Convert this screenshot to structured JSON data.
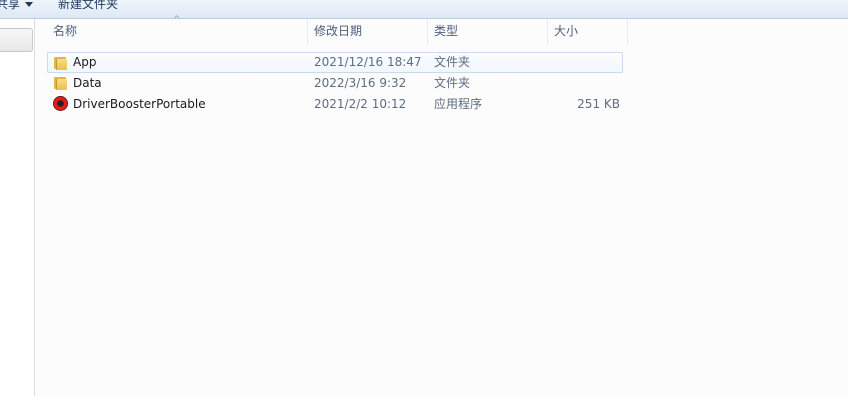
{
  "toolbar": {
    "share_label": "共享",
    "new_folder_label": "新建文件夹"
  },
  "columns": {
    "name": "名称",
    "date": "修改日期",
    "type": "类型",
    "size": "大小"
  },
  "files": [
    {
      "name": "App",
      "date": "2021/12/16 18:47",
      "type": "文件夹",
      "size": "",
      "icon": "folder-icon",
      "selected": true
    },
    {
      "name": "Data",
      "date": "2022/3/16 9:32",
      "type": "文件夹",
      "size": "",
      "icon": "folder-icon",
      "selected": false
    },
    {
      "name": "DriverBoosterPortable",
      "date": "2021/2/2 10:12",
      "type": "应用程序",
      "size": "251 KB",
      "icon": "driver-booster-app-icon",
      "selected": false
    }
  ],
  "colors": {
    "toolbar_bg": "#dde9f6",
    "selection_border": "#c6daf0",
    "header_text": "#4c607a",
    "accent_red": "#e11d1d"
  }
}
